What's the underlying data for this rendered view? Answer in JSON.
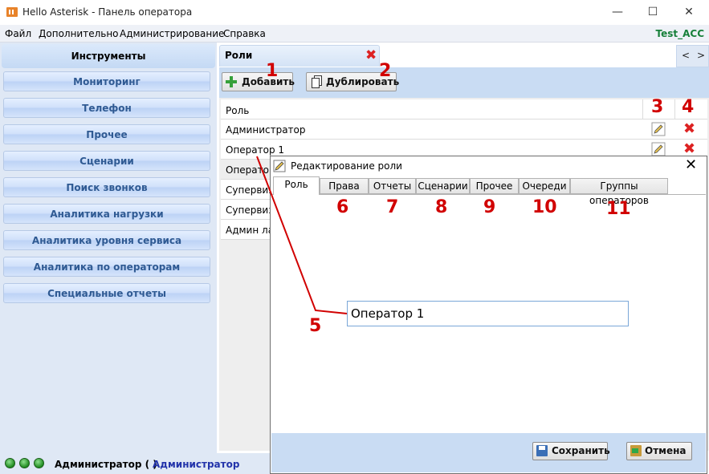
{
  "window": {
    "title": "Hello Asterisk - Панель оператора",
    "minimize": "—",
    "maximize": "☐",
    "close": "✕"
  },
  "menu": {
    "items": [
      "Файл",
      "Дополнительно",
      "Администрирование",
      "Справка"
    ],
    "user": "Test_ACC"
  },
  "sidebar": {
    "header": "Инструменты",
    "items": [
      "Мониторинг",
      "Телефон",
      "Прочее",
      "Сценарии",
      "Поиск звонков",
      "Аналитика нагрузки",
      "Аналитика уровня сервиса",
      "Аналитика по операторам",
      "Специальные отчеты"
    ]
  },
  "status": {
    "role": "Администратор ( )",
    "name": "Администратор"
  },
  "roles": {
    "tab_label": "Роли",
    "close_glyph": "✖",
    "nav_prev": "<",
    "nav_next": ">",
    "add_label": "Добавить",
    "duplicate_label": "Дублировать",
    "column_header": "Роль",
    "rows": [
      "Администратор",
      "Оператор 1",
      "Операто",
      "Супервизо",
      "Супервизо",
      "Админ ла"
    ],
    "edit_glyph": "✎",
    "delete_glyph": "✖"
  },
  "dialog": {
    "title": "Редактирование роли",
    "close": "✕",
    "tabs": [
      "Роль",
      "Права",
      "Отчеты",
      "Сценарии",
      "Прочее",
      "Очереди",
      "Группы операторов"
    ],
    "role_name_value": "Оператор 1",
    "save_label": "Сохранить",
    "cancel_label": "Отмена"
  },
  "annotations": [
    "1",
    "2",
    "3",
    "4",
    "5",
    "6",
    "7",
    "8",
    "9",
    "10",
    "11"
  ],
  "colors": {
    "accent_blue": "#c9dcf3",
    "annotation_red": "#d10000",
    "user_green": "#17803a"
  }
}
